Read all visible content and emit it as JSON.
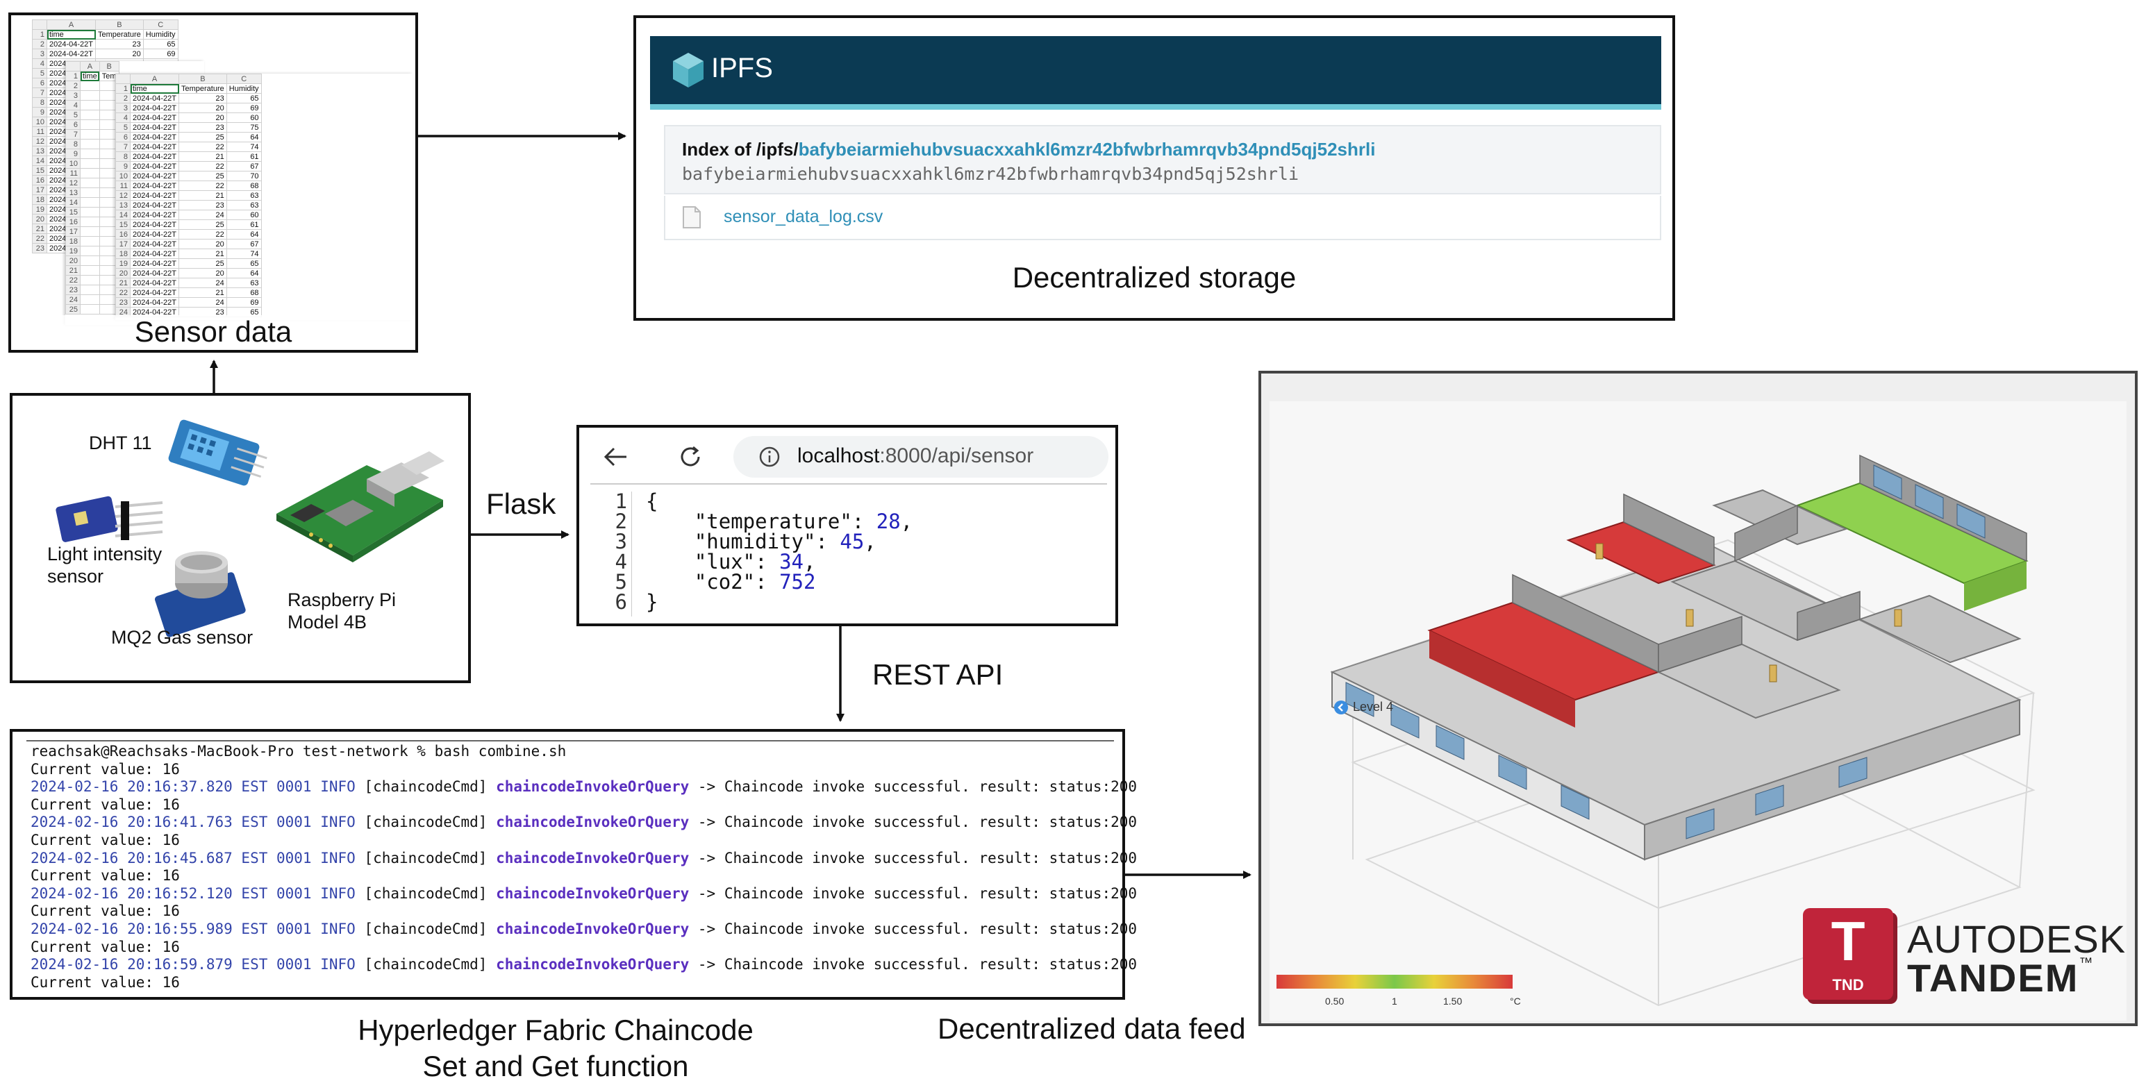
{
  "spreadsheet": {
    "label": "Sensor data",
    "back": {
      "columns": [
        "",
        "A",
        "B",
        "C"
      ],
      "header": [
        "time",
        "Temperature",
        "Humidity"
      ],
      "rows": [
        [
          "2024-04-22T",
          "23",
          "65"
        ],
        [
          "2024-04-22T",
          "20",
          "69"
        ]
      ],
      "row_prefix": "2024"
    },
    "mid": {
      "columns": [
        "",
        "A",
        "B"
      ],
      "header": [
        "time",
        "Tem"
      ]
    },
    "front": {
      "columns": [
        "",
        "A",
        "B",
        "C"
      ],
      "header": [
        "time",
        "Temperature",
        "Humidity"
      ],
      "rows": [
        [
          "2024-04-22T",
          "23",
          "65"
        ],
        [
          "2024-04-22T",
          "20",
          "69"
        ],
        [
          "2024-04-22T",
          "20",
          "60"
        ],
        [
          "2024-04-22T",
          "23",
          "75"
        ],
        [
          "2024-04-22T",
          "25",
          "64"
        ],
        [
          "2024-04-22T",
          "22",
          "74"
        ],
        [
          "2024-04-22T",
          "21",
          "61"
        ],
        [
          "2024-04-22T",
          "22",
          "67"
        ],
        [
          "2024-04-22T",
          "25",
          "70"
        ],
        [
          "2024-04-22T",
          "22",
          "68"
        ],
        [
          "2024-04-22T",
          "21",
          "63"
        ],
        [
          "2024-04-22T",
          "23",
          "63"
        ],
        [
          "2024-04-22T",
          "24",
          "60"
        ],
        [
          "2024-04-22T",
          "25",
          "61"
        ],
        [
          "2024-04-22T",
          "22",
          "64"
        ],
        [
          "2024-04-22T",
          "20",
          "67"
        ],
        [
          "2024-04-22T",
          "21",
          "74"
        ],
        [
          "2024-04-22T",
          "25",
          "65"
        ],
        [
          "2024-04-22T",
          "20",
          "64"
        ],
        [
          "2024-04-22T",
          "24",
          "63"
        ],
        [
          "2024-04-22T",
          "21",
          "68"
        ],
        [
          "2024-04-22T",
          "24",
          "69"
        ],
        [
          "2024-04-22T",
          "23",
          "65"
        ]
      ]
    }
  },
  "ipfs": {
    "brand": "IPFS",
    "index_prefix": "Index of /ipfs/",
    "cid": "bafybeiarmiehubvsuacxxahkl6mzr42bfwbrhamrqvb34pnd5qj52shrli",
    "file": "sensor_data_log.csv",
    "caption": "Decentralized storage"
  },
  "hardware": {
    "dht": "DHT 11",
    "light": [
      "Light intensity",
      "sensor"
    ],
    "mq2": "MQ2 Gas sensor",
    "pi": [
      "Raspberry Pi",
      "Model 4B"
    ]
  },
  "flask_label": "Flask",
  "api": {
    "url_host": "localhost",
    "url_rest": ":8000/api/sensor",
    "lines": [
      {
        "n": "1",
        "text": "{"
      },
      {
        "n": "2",
        "key": "    \"temperature\": ",
        "val": "28",
        "end": ","
      },
      {
        "n": "3",
        "key": "    \"humidity\": ",
        "val": "45",
        "end": ","
      },
      {
        "n": "4",
        "key": "    \"lux\": ",
        "val": "34",
        "end": ","
      },
      {
        "n": "5",
        "key": "    \"co2\": ",
        "val": "752",
        "end": ""
      },
      {
        "n": "6",
        "text": "}"
      }
    ]
  },
  "rest_label": "REST API",
  "terminal": {
    "prompt": "reachsak@Reachsaks-MacBook-Pro test-network % bash combine.sh",
    "current": "Current value: 16",
    "entries": [
      {
        "ts": "2024-02-16 20:16:37.820 EST 0001 INFO"
      },
      {
        "ts": "2024-02-16 20:16:41.763 EST 0001 INFO"
      },
      {
        "ts": "2024-02-16 20:16:45.687 EST 0001 INFO"
      },
      {
        "ts": "2024-02-16 20:16:52.120 EST 0001 INFO"
      },
      {
        "ts": "2024-02-16 20:16:55.989 EST 0001 INFO"
      },
      {
        "ts": "2024-02-16 20:16:59.879 EST 0001 INFO"
      }
    ],
    "cmd": "[chaincodeCmd]",
    "fn": "chaincodeInvokeOrQuery",
    "result": "-> Chaincode invoke successful. result: status:200",
    "caption": [
      "Hyperledger Fabric Chaincode",
      "Set and Get function"
    ]
  },
  "tandem": {
    "level": "Level 4",
    "scale": [
      "0.50",
      "1",
      "1.50",
      "°C"
    ],
    "logo_mark": "T",
    "logo_sub": "TND",
    "brand1": "AUTODESK",
    "brand2": "TANDEM",
    "tm": "™",
    "caption": "Decentralized data feed"
  },
  "colors": {
    "ipfs_bar": "#0b3a53",
    "ipfs_strip": "#6cc6d6",
    "link": "#2f8fb7",
    "tandem_red": "#c0243a",
    "room_red": "#d63a3a",
    "room_green": "#8fd14f"
  }
}
